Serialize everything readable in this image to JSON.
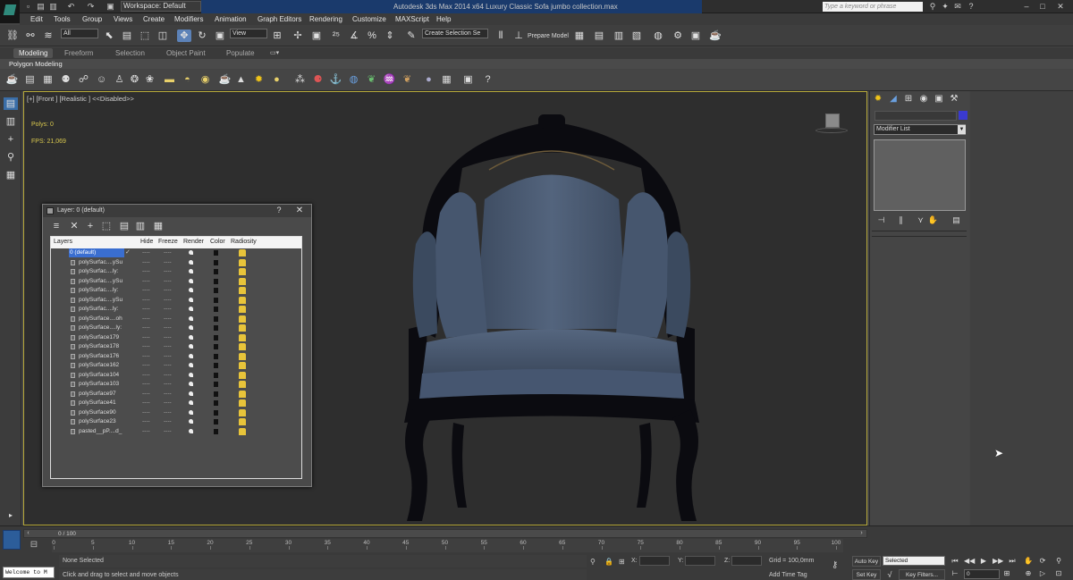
{
  "title_bar": {
    "window_title": "Autodesk 3ds Max  2014 x64     Luxury Classic Sofa jumbo collection.max",
    "workspace": "Workspace: Default",
    "search_placeholder": "Type a keyword or phrase"
  },
  "menu": [
    "Edit",
    "Tools",
    "Group",
    "Views",
    "Create",
    "Modifiers",
    "Animation",
    "Graph Editors",
    "Rendering",
    "Customize",
    "MAXScript",
    "Help"
  ],
  "main_toolbar": {
    "selection_filter": "All",
    "ref_coord": "View",
    "named_selection": "Create Selection Se",
    "prepare_model": "Prepare Model"
  },
  "ribbon": {
    "tabs": [
      "Modeling",
      "Freeform",
      "Selection",
      "Object Paint",
      "Populate"
    ],
    "active_tab": "Modeling",
    "panel_label": "Polygon Modeling"
  },
  "viewport": {
    "label": "[+] [Front ] [Realistic ]  <<Disabled>>",
    "polys": "Polys:     0",
    "fps": "FPS:     21,069",
    "object_colors": {
      "upholstery": "#4e5f78",
      "frame": "#0b0b10"
    }
  },
  "layer_dialog": {
    "title": "Layer: 0 (default)",
    "help": "?",
    "close": "✕",
    "columns": [
      "Layers",
      "Hide",
      "Freeze",
      "Render",
      "Color",
      "Radiosity"
    ],
    "rows": [
      "0 (default)",
      "polySurfac....ySu",
      "polySurfac....ly:",
      "polySurfac....ySu",
      "polySurfac....ly:",
      "polySurfac....ySu",
      "polySurfac....ly:",
      "polySurface....oh",
      "polySurface....ly:",
      "polySurface179",
      "polySurface178",
      "polySurface176",
      "polySurface162",
      "polySurface104",
      "polySurface103",
      "polySurface97",
      "polySurface41",
      "polySurface90",
      "polySurface23",
      "pasted__pP....d_"
    ],
    "dash": "----"
  },
  "command_panel": {
    "modifier_list": "Modifier List"
  },
  "timeline": {
    "frame_label": "0 / 100",
    "ticks": [
      "0",
      "5",
      "10",
      "15",
      "20",
      "25",
      "30",
      "35",
      "40",
      "45",
      "50",
      "55",
      "60",
      "65",
      "70",
      "75",
      "80",
      "85",
      "90",
      "95",
      "100"
    ]
  },
  "status": {
    "maxscript": "Welcome to M",
    "selection": "None Selected",
    "prompt": "Click and drag to select and move objects",
    "x_label": "X:",
    "y_label": "Y:",
    "z_label": "Z:",
    "grid": "Grid = 100,0mm",
    "add_time_tag": "Add Time Tag",
    "auto_key": "Auto Key",
    "set_key": "Set Key",
    "selected_dd": "Selected",
    "key_filters": "Key Filters...",
    "frame": "0"
  }
}
